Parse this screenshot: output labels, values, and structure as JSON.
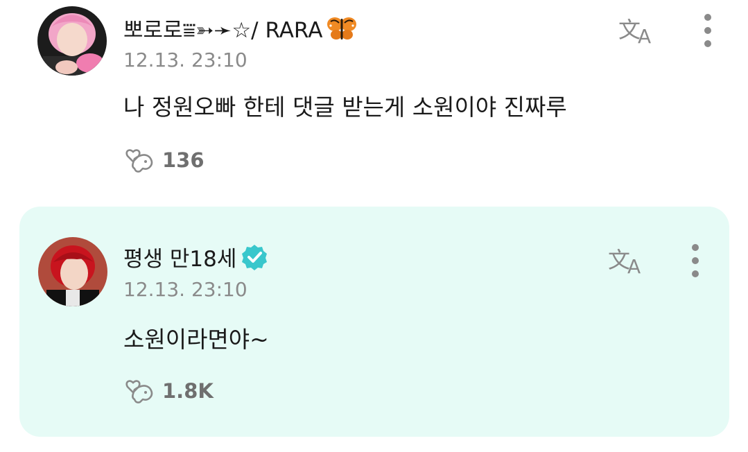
{
  "comments": [
    {
      "username": "뽀로로⩸➳➛☆/ RARA",
      "timestamp": "12.13. 23:10",
      "text": "나 정원오빠 한테 댓글 받는게 소원이야 진짜루",
      "likes": "136",
      "avatar_icon": "avatar-pink-hair",
      "name_emoji": "butterfly-icon"
    },
    {
      "username": "평생 만18세",
      "timestamp": "12.13. 23:10",
      "text": "소원이라면야~",
      "likes": "1.8K",
      "avatar_icon": "avatar-red-hair",
      "verified": true
    }
  ],
  "colors": {
    "reply_background": "#e6fbf6",
    "verified_badge": "#39c7cc",
    "text_primary": "#1a1a1a",
    "text_secondary": "#8a8a8a",
    "icon_gray": "#8a8a8a"
  }
}
